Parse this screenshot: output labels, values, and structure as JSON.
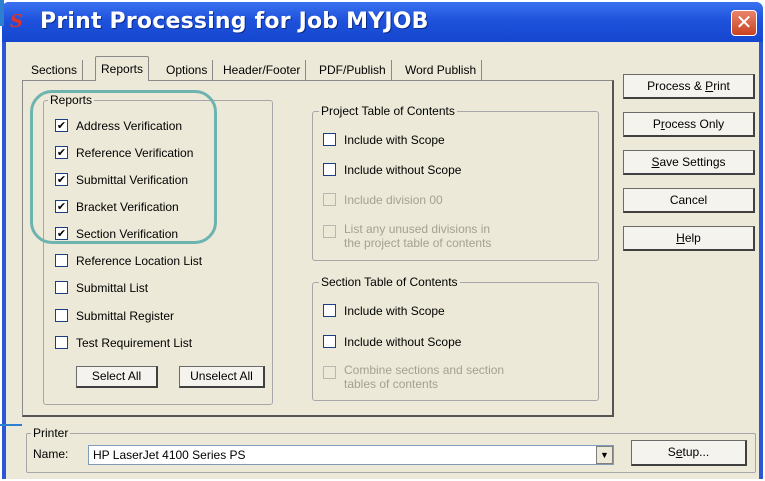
{
  "window": {
    "title": "Print Processing for Job MYJOB",
    "icon": "app-logo-icon",
    "icon_glyph": "S",
    "close_glyph": "✕"
  },
  "tabs": [
    {
      "label": "Sections",
      "active": false
    },
    {
      "label": "Reports",
      "active": true
    },
    {
      "label": "Options",
      "active": false
    },
    {
      "label": "Header/Footer",
      "active": false
    },
    {
      "label": "PDF/Publish",
      "active": false
    },
    {
      "label": "Word Publish",
      "active": false
    }
  ],
  "reports": {
    "group_label": "Reports",
    "items": [
      {
        "label": "Address Verification",
        "checked": true
      },
      {
        "label": "Reference Verification",
        "checked": true
      },
      {
        "label": "Submittal Verification",
        "checked": true
      },
      {
        "label": "Bracket Verification",
        "checked": true
      },
      {
        "label": "Section Verification",
        "checked": true
      },
      {
        "label": "Reference Location List",
        "checked": false
      },
      {
        "label": "Submittal List",
        "checked": false
      },
      {
        "label": "Submittal Register",
        "checked": false
      },
      {
        "label": "Test Requirement List",
        "checked": false
      }
    ],
    "select_all": "Select All",
    "unselect_all": "Unselect All"
  },
  "project_toc": {
    "group_label": "Project Table of Contents",
    "items": [
      {
        "label": "Include with Scope",
        "checked": false,
        "enabled": true
      },
      {
        "label": "Include without Scope",
        "checked": false,
        "enabled": true
      },
      {
        "label": "Include division 00",
        "checked": false,
        "enabled": false
      },
      {
        "label_line1": "List any unused divisions in",
        "label_line2": "the project table of contents",
        "checked": false,
        "enabled": false
      }
    ]
  },
  "section_toc": {
    "group_label": "Section Table of Contents",
    "items": [
      {
        "label": "Include with Scope",
        "checked": false,
        "enabled": true
      },
      {
        "label": "Include without Scope",
        "checked": false,
        "enabled": true
      },
      {
        "label_line1": "Combine sections and section",
        "label_line2": "tables of contents",
        "checked": false,
        "enabled": false
      }
    ]
  },
  "buttons": {
    "process_print": {
      "pre": "Process & ",
      "accel": "P",
      "post": "rint"
    },
    "process_only": {
      "pre": "P",
      "accel": "r",
      "post": "ocess Only"
    },
    "save_settings": {
      "pre": "",
      "accel": "S",
      "post": "ave Settings"
    },
    "cancel": "Cancel",
    "help": {
      "pre": "",
      "accel": "H",
      "post": "elp"
    }
  },
  "printer": {
    "group_label": "Printer",
    "name_label": "Name:",
    "name_value": "HP LaserJet 4100 Series PS",
    "setup": {
      "pre": "S",
      "accel": "e",
      "post": "tup..."
    }
  },
  "colors": {
    "title_bar": "#1f52dc",
    "dialog_bg": "#ece9d8",
    "highlight_oval": "#6db3b0",
    "close_button": "#c94222"
  }
}
